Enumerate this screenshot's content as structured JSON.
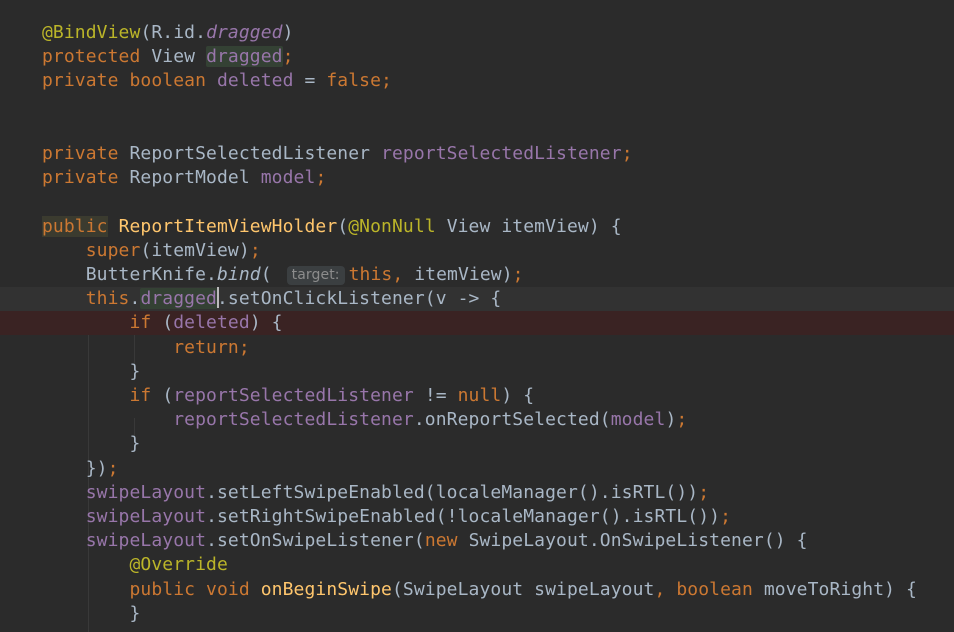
{
  "colors": {
    "background": "#2b2b2b",
    "keyword": "#cc7832",
    "text": "#a9b7c6",
    "field": "#9876aa",
    "annotation": "#bbb529",
    "method": "#ffc66d"
  },
  "code_lines": [
    [
      [
        "a",
        "@BindView"
      ],
      [
        "t",
        "(R.id."
      ],
      [
        "fi",
        "dragged"
      ],
      [
        "t",
        ")"
      ]
    ],
    [
      [
        "k",
        "protected "
      ],
      [
        "t",
        "View "
      ],
      [
        "f hl",
        "dragged"
      ],
      [
        "k",
        ";"
      ]
    ],
    [
      [
        "k",
        "private boolean "
      ],
      [
        "f",
        "deleted "
      ],
      [
        "t",
        "= "
      ],
      [
        "k",
        "false;"
      ]
    ],
    [],
    [],
    [
      [
        "k",
        "private "
      ],
      [
        "t",
        "ReportSelectedListener "
      ],
      [
        "f",
        "reportSelectedListener"
      ],
      [
        "k",
        ";"
      ]
    ],
    [
      [
        "k",
        "private "
      ],
      [
        "t",
        "ReportModel "
      ],
      [
        "f",
        "model"
      ],
      [
        "k",
        ";"
      ]
    ],
    [],
    [
      [
        "k hlk",
        "public"
      ],
      [
        "t",
        " "
      ],
      [
        "m",
        "ReportItemViewHolder"
      ],
      [
        "t",
        "("
      ],
      [
        "a",
        "@NonNull "
      ],
      [
        "t",
        "View itemView) {"
      ]
    ],
    [
      [
        "t",
        "    "
      ],
      [
        "k",
        "super"
      ],
      [
        "t",
        "(itemView)"
      ],
      [
        "k",
        ";"
      ]
    ],
    [
      [
        "t",
        "    ButterKnife."
      ],
      [
        "sm",
        "bind"
      ],
      [
        "t",
        "( "
      ],
      [
        "hint",
        "target:"
      ],
      [
        "k",
        "this, "
      ],
      [
        "t",
        "itemView)"
      ],
      [
        "k",
        ";"
      ]
    ],
    [
      [
        "t",
        "    "
      ],
      [
        "k",
        "this"
      ],
      [
        "t",
        "."
      ],
      [
        "f hl",
        "dragged"
      ],
      [
        "caret",
        ""
      ],
      [
        "t",
        ".setOnClickListener(v -> {"
      ]
    ],
    [
      [
        "t",
        "        "
      ],
      [
        "k",
        "if "
      ],
      [
        "t",
        "("
      ],
      [
        "f",
        "deleted"
      ],
      [
        "t",
        ") {"
      ]
    ],
    [
      [
        "t",
        "            "
      ],
      [
        "k",
        "return;"
      ]
    ],
    [
      [
        "t",
        "        }"
      ]
    ],
    [
      [
        "t",
        "        "
      ],
      [
        "k",
        "if "
      ],
      [
        "t",
        "("
      ],
      [
        "f",
        "reportSelectedListener "
      ],
      [
        "t",
        "!= "
      ],
      [
        "k",
        "null"
      ],
      [
        "t",
        ") {"
      ]
    ],
    [
      [
        "t",
        "            "
      ],
      [
        "f",
        "reportSelectedListener"
      ],
      [
        "t",
        ".onReportSelected("
      ],
      [
        "f",
        "model"
      ],
      [
        "t",
        ")"
      ],
      [
        "k",
        ";"
      ]
    ],
    [
      [
        "t",
        "        }"
      ]
    ],
    [
      [
        "t",
        "    })"
      ],
      [
        "k",
        ";"
      ]
    ],
    [
      [
        "t",
        "    "
      ],
      [
        "f",
        "swipeLayout"
      ],
      [
        "t",
        ".setLeftSwipeEnabled(localeManager().isRTL())"
      ],
      [
        "k",
        ";"
      ]
    ],
    [
      [
        "t",
        "    "
      ],
      [
        "f",
        "swipeLayout"
      ],
      [
        "t",
        ".setRightSwipeEnabled(!localeManager().isRTL())"
      ],
      [
        "k",
        ";"
      ]
    ],
    [
      [
        "t",
        "    "
      ],
      [
        "f",
        "swipeLayout"
      ],
      [
        "t",
        ".setOnSwipeListener("
      ],
      [
        "k",
        "new "
      ],
      [
        "t",
        "SwipeLayout.OnSwipeListener() {"
      ]
    ],
    [
      [
        "t",
        "        "
      ],
      [
        "a",
        "@Override"
      ]
    ],
    [
      [
        "t",
        "        "
      ],
      [
        "k",
        "public void "
      ],
      [
        "m",
        "onBeginSwipe"
      ],
      [
        "t",
        "(SwipeLayout swipeLayout"
      ],
      [
        "k",
        ", boolean "
      ],
      [
        "t",
        "moveToRight) {"
      ]
    ],
    [
      [
        "t",
        "        }"
      ]
    ]
  ]
}
